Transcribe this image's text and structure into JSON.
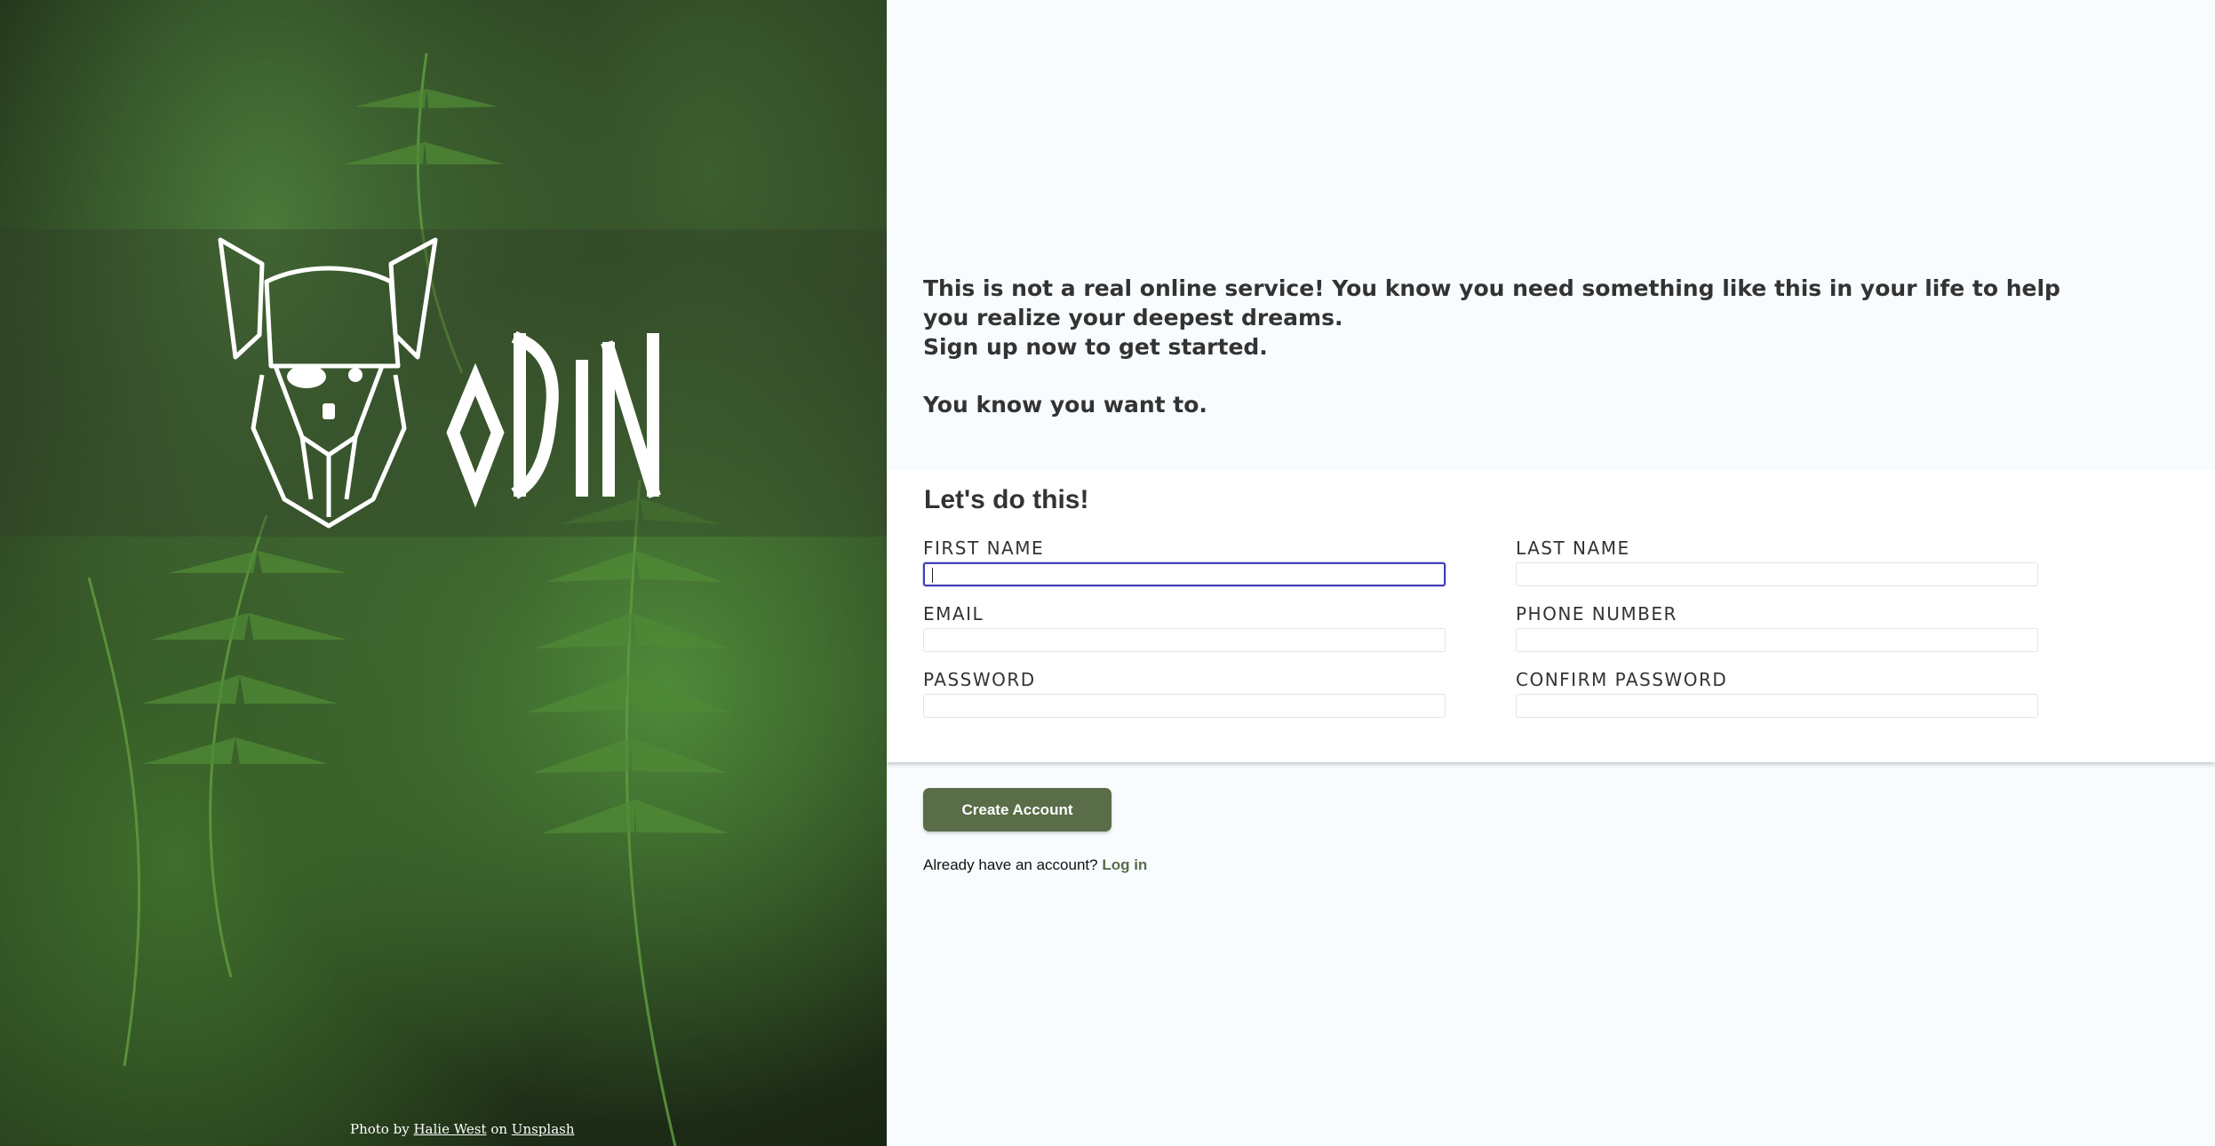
{
  "sidebar": {
    "logo_text": "ODIN",
    "credit": {
      "prefix": "Photo by",
      "author": "Halie West",
      "middle": "on",
      "source": "Unsplash"
    }
  },
  "intro": {
    "line1": "This is not a real online service! You know you need something like this in your life to help you realize your deepest dreams.",
    "line2": "Sign up now to get started.",
    "line3": "You know you want to."
  },
  "form": {
    "title": "Let's do this!",
    "fields": [
      {
        "label": "FIRST NAME",
        "value": ""
      },
      {
        "label": "LAST NAME",
        "value": ""
      },
      {
        "label": "EMAIL",
        "value": ""
      },
      {
        "label": "PHONE NUMBER",
        "value": ""
      },
      {
        "label": "PASSWORD",
        "value": ""
      },
      {
        "label": "CONFIRM PASSWORD",
        "value": ""
      }
    ]
  },
  "actions": {
    "create_label": "Create Account",
    "login_prompt": "Already have an account?",
    "login_link": "Log in"
  },
  "colors": {
    "accent": "#596d48",
    "focus": "#3f3fb8",
    "background": "#f8fcfe"
  }
}
